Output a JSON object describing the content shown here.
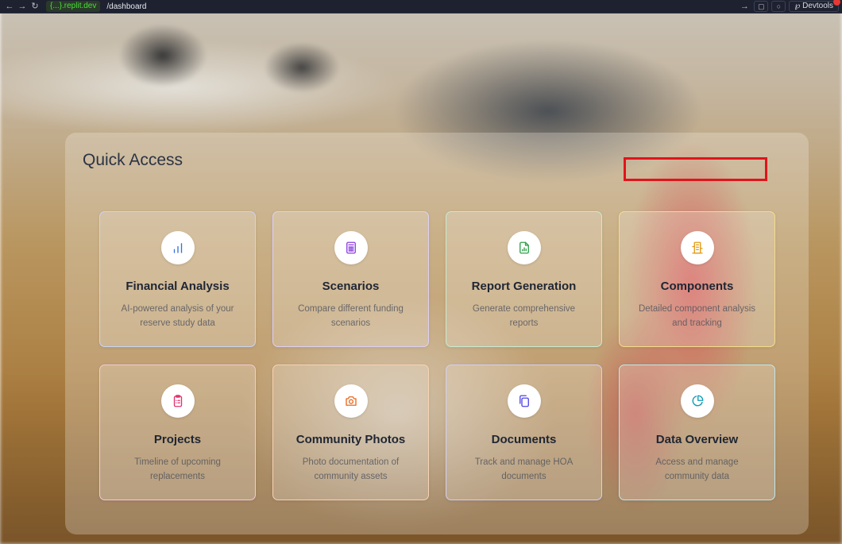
{
  "browser": {
    "host": "{...}.replit.dev",
    "path": "/dashboard",
    "devtools_label": "Devtools"
  },
  "page": {
    "section_title": "Quick Access"
  },
  "cards": [
    {
      "title": "Financial Analysis",
      "description": "AI-powered analysis of your reserve study data",
      "icon": "bar-chart-icon",
      "accent": "#3b6fe0",
      "border": "#c9d5f5"
    },
    {
      "title": "Scenarios",
      "description": "Compare different funding scenarios",
      "icon": "calculator-icon",
      "accent": "#8b3fe0",
      "border": "#ddd0f5"
    },
    {
      "title": "Report Generation",
      "description": "Generate comprehensive reports",
      "icon": "file-chart-icon",
      "accent": "#2fa04a",
      "border": "#c6ecd0"
    },
    {
      "title": "Components",
      "description": "Detailed component analysis and tracking",
      "icon": "building-icon",
      "accent": "#e39a12",
      "border": "#f6dc88"
    },
    {
      "title": "Projects",
      "description": "Timeline of upcoming replacements",
      "icon": "clipboard-list-icon",
      "accent": "#e0336e",
      "border": "#f5c9d6"
    },
    {
      "title": "Community Photos",
      "description": "Photo documentation of community assets",
      "icon": "camera-icon",
      "accent": "#ea6a1c",
      "border": "#f7d4b4"
    },
    {
      "title": "Documents",
      "description": "Track and manage HOA documents",
      "icon": "copy-icon",
      "accent": "#4f46e5",
      "border": "#d2d0f5"
    },
    {
      "title": "Data Overview",
      "description": "Access and manage community data",
      "icon": "pie-chart-icon",
      "accent": "#0e9bb5",
      "border": "#bfe8ee"
    }
  ]
}
